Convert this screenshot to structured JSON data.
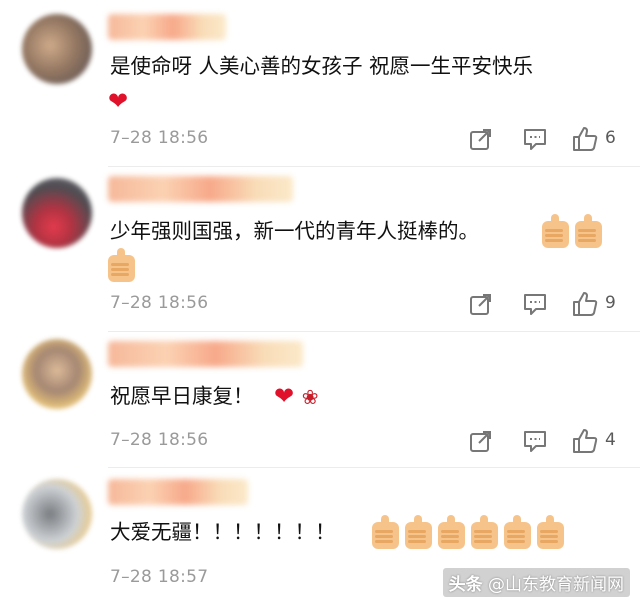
{
  "comments": [
    {
      "text": "是使命呀 人美心善的女孩子 祝愿一生平安快乐",
      "emoji": "❤️",
      "time": "7–28 18:56",
      "likes": "6"
    },
    {
      "text": "少年强则国强，新一代的青年人挺棒的。",
      "emoji": "👍👍👍",
      "time": "7–28 18:56",
      "likes": "9"
    },
    {
      "text": "祝愿早日康复！",
      "emoji": "❤️🌹",
      "time": "7–28 18:56",
      "likes": "4"
    },
    {
      "text": "大爱无疆！！！！！！！",
      "emoji": "👍👍👍👍👍👍",
      "time": "7–28 18:57",
      "likes": ""
    }
  ],
  "watermark": {
    "brand": "头条",
    "handle": "@山东教育新闻网"
  },
  "icons": {
    "share": "share-icon",
    "reply": "reply-icon",
    "like": "thumbs-up-icon"
  },
  "colors": {
    "meta": "#9a9a9a",
    "heart": "#e0112b",
    "divider": "#ececec"
  }
}
